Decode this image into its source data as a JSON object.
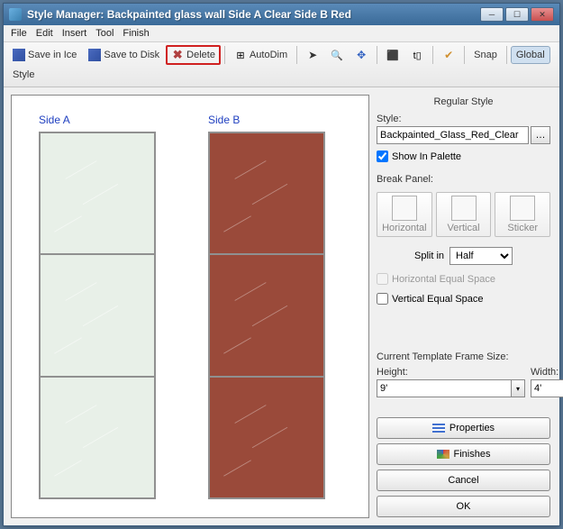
{
  "window": {
    "title": "Style Manager: Backpainted glass wall Side A Clear Side B Red"
  },
  "menu": {
    "file": "File",
    "edit": "Edit",
    "insert": "Insert",
    "tool": "Tool",
    "finish": "Finish"
  },
  "toolbar": {
    "save_ice": "Save in Ice",
    "save_disk": "Save to Disk",
    "delete": "Delete",
    "autodim": "AutoDim",
    "snap": "Snap",
    "global": "Global",
    "style": "Style"
  },
  "preview": {
    "side_a": "Side A",
    "side_b": "Side B"
  },
  "panel": {
    "section_title": "Regular Style",
    "style_label": "Style:",
    "style_value": "Backpainted_Glass_Red_Clear",
    "show_in_palette": "Show In Palette",
    "break_panel_label": "Break Panel:",
    "break_horizontal": "Horizontal",
    "break_vertical": "Vertical",
    "break_sticker": "Sticker",
    "split_in": "Split in",
    "split_value": "Half",
    "horiz_equal": "Horizontal Equal Space",
    "vert_equal": "Vertical Equal Space",
    "frame_size_label": "Current Template Frame Size:",
    "height_label": "Height:",
    "height_value": "9'",
    "width_label": "Width:",
    "width_value": "4'",
    "properties": "Properties",
    "finishes": "Finishes",
    "cancel": "Cancel",
    "ok": "OK"
  }
}
